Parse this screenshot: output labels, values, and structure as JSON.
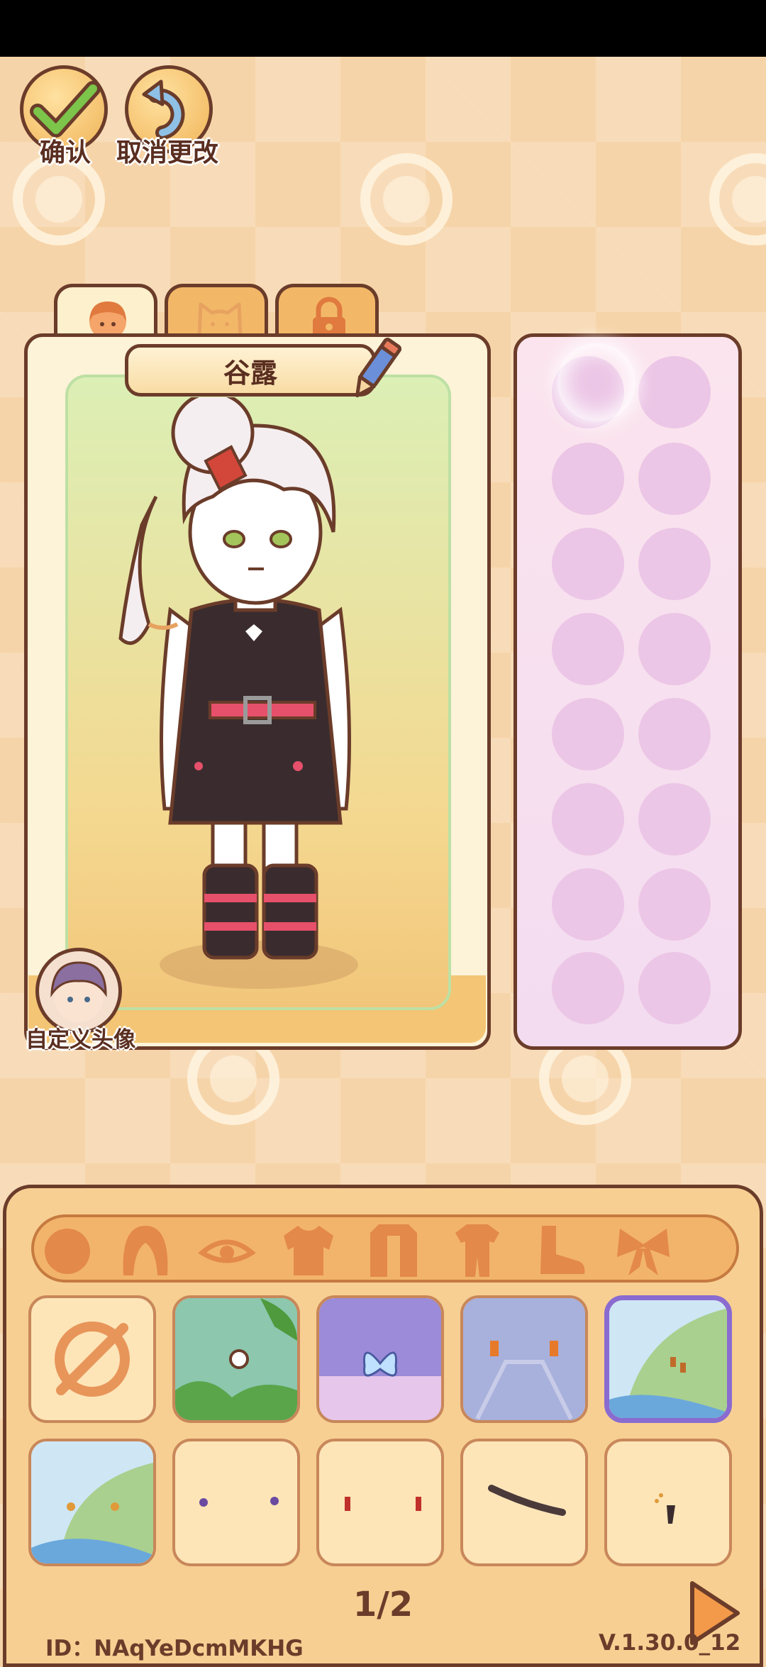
{
  "header": {
    "confirm_label": "确认",
    "cancel_label": "取消更改"
  },
  "tabs": [
    {
      "icon": "girl-face-icon",
      "active": true
    },
    {
      "icon": "cat-face-icon",
      "active": false
    },
    {
      "icon": "lock-icon",
      "active": false
    }
  ],
  "character": {
    "name": "谷露",
    "edit_icon": "pencil-icon",
    "custom_avatar_label": "自定义头像"
  },
  "categories": [
    "head-icon",
    "hair-icon",
    "eye-icon",
    "top-icon",
    "jacket-icon",
    "outfit-icon",
    "shoe-icon",
    "bow-icon"
  ],
  "items": [
    {
      "icon": "none-icon",
      "selected": false
    },
    {
      "icon": "forest-background-icon",
      "selected": false
    },
    {
      "icon": "butterfly-sky-background-icon",
      "selected": false
    },
    {
      "icon": "rain-bridge-background-icon",
      "selected": false
    },
    {
      "icon": "leaf-background-icon",
      "selected": true
    },
    {
      "icon": "leaf-earrings-icon",
      "selected": false
    },
    {
      "icon": "stud-earrings-icon",
      "selected": false
    },
    {
      "icon": "drop-earrings-icon",
      "selected": false
    },
    {
      "icon": "branch-accessory-icon",
      "selected": false
    },
    {
      "icon": "sparkle-earring-icon",
      "selected": false
    }
  ],
  "pager": {
    "text": "1/2"
  },
  "footer": {
    "id": "ID：NAqYeDcmMKHG",
    "version": "V.1.30.0_12"
  },
  "colors": {
    "outline": "#6b3c2a",
    "background": "#f6d4a9",
    "selected_border": "#8a6bd0",
    "slot": "#ecc6e6"
  }
}
